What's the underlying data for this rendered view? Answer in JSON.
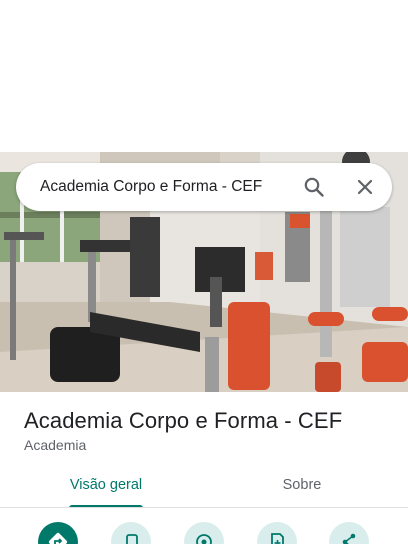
{
  "search": {
    "query": "Academia Corpo e Forma - CEF",
    "search_icon": "search-icon",
    "clear_icon": "close-icon"
  },
  "place": {
    "title": "Academia Corpo e Forma - CEF",
    "category": "Academia"
  },
  "tabs": [
    {
      "label": "Visão geral",
      "selected": true
    },
    {
      "label": "Sobre",
      "selected": false
    }
  ],
  "actions": [
    {
      "icon": "directions-icon"
    },
    {
      "icon": "phone-icon"
    },
    {
      "icon": "location-icon"
    },
    {
      "icon": "save-icon"
    },
    {
      "icon": "share-icon"
    }
  ],
  "colors": {
    "accent": "#00796b",
    "accent_light": "#d9eeec",
    "secondary_text": "#5f6368"
  }
}
